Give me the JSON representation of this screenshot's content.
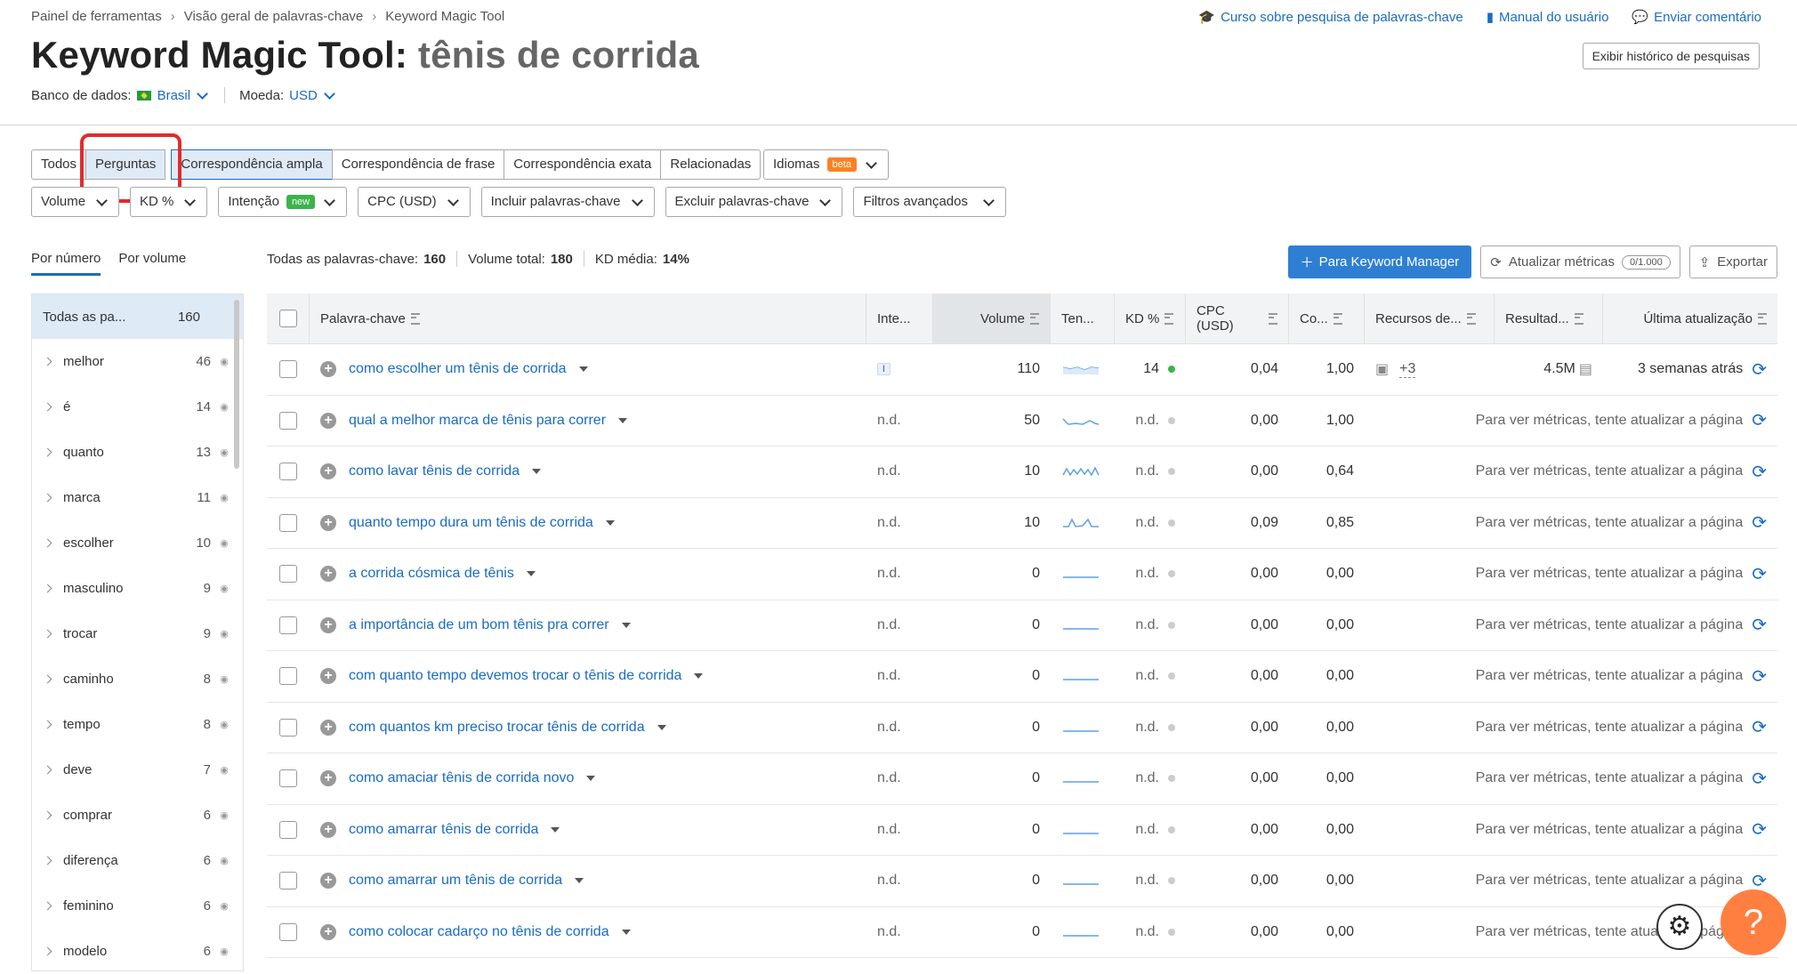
{
  "breadcrumb": [
    "Painel de ferramentas",
    "Visão geral de palavras-chave",
    "Keyword Magic Tool"
  ],
  "toplinks": [
    "Curso sobre pesquisa de palavras-chave",
    "Manual do usuário",
    "Enviar comentário"
  ],
  "title": {
    "tool": "Keyword Magic Tool:",
    "query": "tênis de corrida"
  },
  "history_button": "Exibir histórico de pesquisas",
  "db": {
    "label": "Banco de dados:",
    "value": "Brasil",
    "currency_label": "Moeda:",
    "currency": "USD"
  },
  "tabs": [
    "Todos",
    "Perguntas",
    "Correspondência ampla",
    "Correspondência de frase",
    "Correspondência exata",
    "Relacionadas"
  ],
  "lang": {
    "label": "Idiomas",
    "badge": "beta"
  },
  "filters": {
    "volume": "Volume",
    "kd": "KD %",
    "intent": "Intenção",
    "intent_badge": "new",
    "cpc": "CPC (USD)",
    "include": "Incluir palavras-chave",
    "exclude": "Excluir palavras-chave",
    "advanced": "Filtros avançados"
  },
  "subtabs": [
    "Por número",
    "Por volume"
  ],
  "stats": {
    "all_label": "Todas as palavras-chave:",
    "all": "160",
    "vol_label": "Volume total:",
    "vol": "180",
    "kd_label": "KD média:",
    "kd": "14%"
  },
  "actions": {
    "manager": "Para Keyword Manager",
    "update": "Atualizar métricas",
    "update_pill": "0/1.000",
    "export": "Exportar"
  },
  "sidebar": {
    "head_label": "Todas as pa...",
    "head_count": "160",
    "items": [
      {
        "word": "melhor",
        "count": "46"
      },
      {
        "word": "é",
        "count": "14"
      },
      {
        "word": "quanto",
        "count": "13"
      },
      {
        "word": "marca",
        "count": "11"
      },
      {
        "word": "escolher",
        "count": "10"
      },
      {
        "word": "masculino",
        "count": "9"
      },
      {
        "word": "trocar",
        "count": "9"
      },
      {
        "word": "caminho",
        "count": "8"
      },
      {
        "word": "tempo",
        "count": "8"
      },
      {
        "word": "deve",
        "count": "7"
      },
      {
        "word": "comprar",
        "count": "6"
      },
      {
        "word": "diferença",
        "count": "6"
      },
      {
        "word": "feminino",
        "count": "6"
      },
      {
        "word": "modelo",
        "count": "6"
      }
    ]
  },
  "columns": [
    "Palavra-chave",
    "Inte...",
    "Volume",
    "Ten...",
    "KD %",
    "CPC (USD)",
    "Co...",
    "Recursos de...",
    "Resultad...",
    "Última atualização"
  ],
  "rows": [
    {
      "kw": "como escolher um tênis de corrida",
      "intent": "I",
      "volume": "110",
      "kd": "14",
      "cpc": "0,04",
      "com": "1,00",
      "features_more": "+3",
      "results": "4.5M",
      "updated": "3 semanas atrás"
    },
    {
      "kw": "qual a melhor marca de tênis para correr",
      "intent": "n.d.",
      "volume": "50",
      "kd": "n.d.",
      "cpc": "0,00",
      "com": "1,00",
      "msg": "Para ver métricas, tente atualizar a página"
    },
    {
      "kw": "como lavar tênis de corrida",
      "intent": "n.d.",
      "volume": "10",
      "kd": "n.d.",
      "cpc": "0,00",
      "com": "0,64",
      "msg": "Para ver métricas, tente atualizar a página"
    },
    {
      "kw": "quanto tempo dura um tênis de corrida",
      "intent": "n.d.",
      "volume": "10",
      "kd": "n.d.",
      "cpc": "0,09",
      "com": "0,85",
      "msg": "Para ver métricas, tente atualizar a página"
    },
    {
      "kw": "a corrida cósmica de tênis",
      "intent": "n.d.",
      "volume": "0",
      "kd": "n.d.",
      "cpc": "0,00",
      "com": "0,00",
      "msg": "Para ver métricas, tente atualizar a página"
    },
    {
      "kw": "a importância de um bom tênis pra correr",
      "intent": "n.d.",
      "volume": "0",
      "kd": "n.d.",
      "cpc": "0,00",
      "com": "0,00",
      "msg": "Para ver métricas, tente atualizar a página"
    },
    {
      "kw": "com quanto tempo devemos trocar o tênis de corrida",
      "intent": "n.d.",
      "volume": "0",
      "kd": "n.d.",
      "cpc": "0,00",
      "com": "0,00",
      "msg": "Para ver métricas, tente atualizar a página"
    },
    {
      "kw": "com quantos km preciso trocar tênis de corrida",
      "intent": "n.d.",
      "volume": "0",
      "kd": "n.d.",
      "cpc": "0,00",
      "com": "0,00",
      "msg": "Para ver métricas, tente atualizar a página"
    },
    {
      "kw": "como amaciar tênis de corrida novo",
      "intent": "n.d.",
      "volume": "0",
      "kd": "n.d.",
      "cpc": "0,00",
      "com": "0,00",
      "msg": "Para ver métricas, tente atualizar a página"
    },
    {
      "kw": "como amarrar tênis de corrida",
      "intent": "n.d.",
      "volume": "0",
      "kd": "n.d.",
      "cpc": "0,00",
      "com": "0,00",
      "msg": "Para ver métricas, tente atualizar a página"
    },
    {
      "kw": "como amarrar um tênis de corrida",
      "intent": "n.d.",
      "volume": "0",
      "kd": "n.d.",
      "cpc": "0,00",
      "com": "0,00",
      "msg": "Para ver métricas, tente atualizar a página"
    },
    {
      "kw": "como colocar cadarço no tênis de corrida",
      "intent": "n.d.",
      "volume": "0",
      "kd": "n.d.",
      "cpc": "0,00",
      "com": "0,00",
      "msg": "Para ver métricas, tente atualizar a página"
    }
  ],
  "help": "?",
  "colors": {
    "link": "#1a6bc6",
    "accent": "#2e7fd4",
    "highlight": "#e22b2b",
    "help": "#ff7f41",
    "kd_green": "#3ab44b"
  }
}
